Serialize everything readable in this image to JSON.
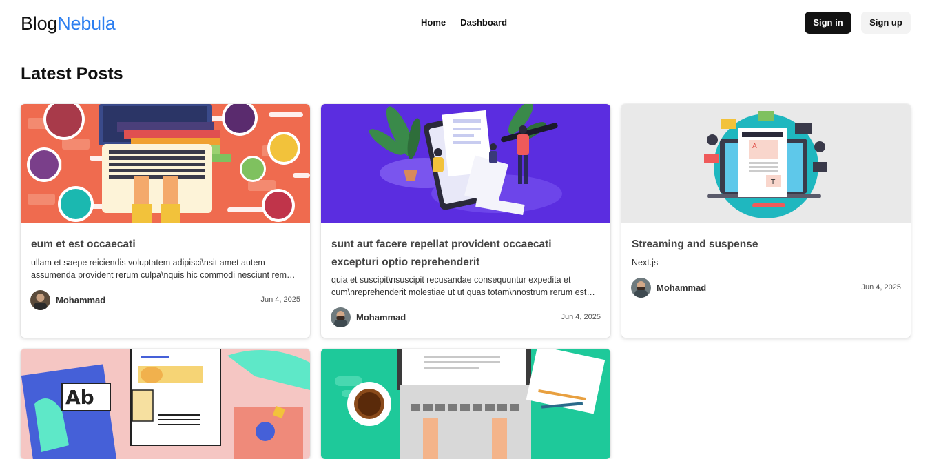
{
  "header": {
    "logo_part1": "Blog",
    "logo_part2": "Nebula",
    "nav": [
      "Home",
      "Dashboard"
    ],
    "signin_label": "Sign in",
    "signup_label": "Sign up"
  },
  "main": {
    "heading": "Latest Posts",
    "posts": [
      {
        "title": "eum et est occaecati",
        "description": "ullam et saepe reiciendis voluptatem adipisci\\nsit amet autem assumenda provident rerum culpa\\nquis hic commodi nesciunt rem tenetur doloremque ipsam iure",
        "author": "Mohammad",
        "date": "Jun 4, 2025"
      },
      {
        "title": "sunt aut facere repellat provident occaecati excepturi optio reprehenderit",
        "description": "quia et suscipit\\nsuscipit recusandae consequuntur expedita et cum\\nreprehenderit molestiae ut ut quas totam\\nnostrum rerum est autem sunt rem eveniet architecto",
        "author": "Mohammad",
        "date": "Jun 4, 2025"
      },
      {
        "title": "Streaming and suspense",
        "description": "Next.js",
        "author": "Mohammad",
        "date": "Jun 4, 2025"
      }
    ]
  },
  "colors": {
    "accent": "#2d7ff0",
    "thumb1_bg": "#ef6b4f",
    "thumb2_bg": "#5b2de0",
    "thumb3_bg": "#e9e9e9",
    "thumb4_bg": "#f5c6c3",
    "thumb5_bg": "#1ec99a"
  }
}
